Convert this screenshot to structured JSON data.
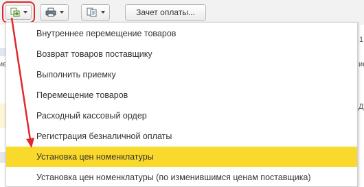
{
  "toolbar": {
    "create_based_on": {
      "icon": "create-based-on-icon",
      "has_dropdown": true,
      "highlight_color": "#e0282a"
    },
    "print": {
      "icon": "printer-icon",
      "has_dropdown": true
    },
    "related_docs": {
      "icon": "documents-icon",
      "has_dropdown": true
    },
    "payment_offset_label": "Зачет оплаты..."
  },
  "background_edge": {
    "left_fragment": "ие",
    "right_fragments": [
      "1.",
      "ие",
      "Д"
    ]
  },
  "menu": {
    "items": [
      {
        "label": "Внутреннее перемещение товаров",
        "selected": false
      },
      {
        "label": "Возврат товаров поставщику",
        "selected": false
      },
      {
        "label": "Выполнить приемку",
        "selected": false
      },
      {
        "label": "Перемещение товаров",
        "selected": false
      },
      {
        "label": "Расходный кассовый ордер",
        "selected": false
      },
      {
        "label": "Регистрация безналичной оплаты",
        "selected": false
      },
      {
        "label": "Установка цен номенклатуры",
        "selected": true
      },
      {
        "label": "Установка цен номенклатуры (по изменившимся ценам поставщика)",
        "selected": false
      }
    ],
    "selected_color": "#f9d92b"
  },
  "annotation": {
    "color": "#e0282a"
  }
}
